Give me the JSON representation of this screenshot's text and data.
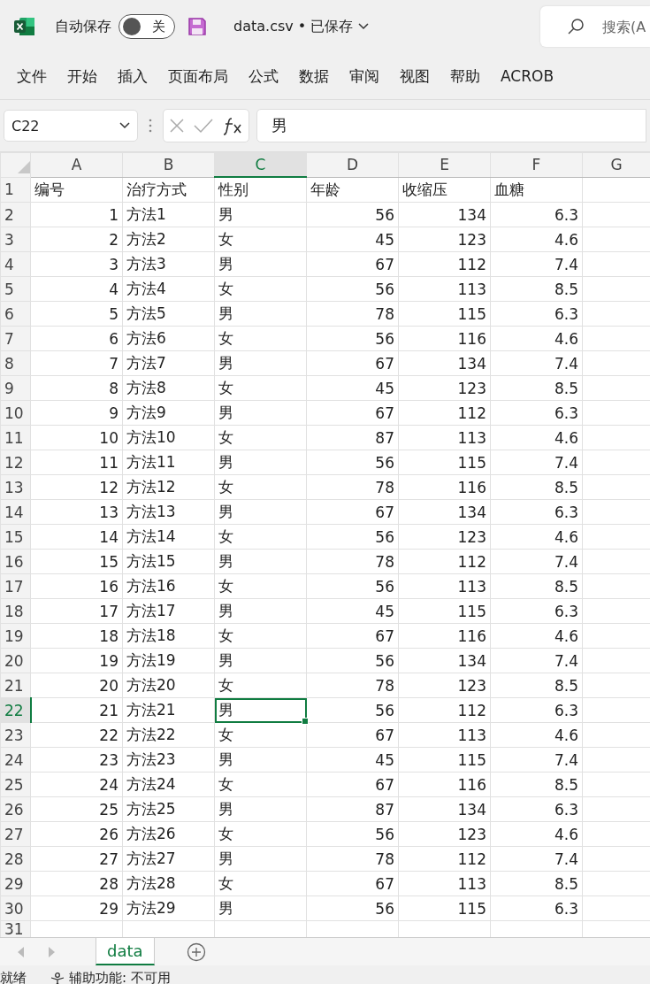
{
  "title_bar": {
    "autosave_label": "自动保存",
    "autosave_on": false,
    "autosave_state": "关",
    "file_title": "data.csv • 已保存",
    "search": {
      "placeholder": "搜索(A"
    }
  },
  "ribbon_tabs": [
    {
      "label": "文件",
      "selected": false
    },
    {
      "label": "开始",
      "selected": false
    },
    {
      "label": "插入",
      "selected": false
    },
    {
      "label": "页面布局",
      "selected": false
    },
    {
      "label": "公式",
      "selected": false
    },
    {
      "label": "数据",
      "selected": false
    },
    {
      "label": "审阅",
      "selected": false
    },
    {
      "label": "视图",
      "selected": false
    },
    {
      "label": "帮助",
      "selected": false
    },
    {
      "label": "ACROB",
      "selected": false
    }
  ],
  "formula_bar": {
    "name_box": "C22",
    "value": "男"
  },
  "grid": {
    "columns": [
      {
        "label": "A",
        "kind": "number",
        "selected": false
      },
      {
        "label": "B",
        "kind": "text",
        "selected": false
      },
      {
        "label": "C",
        "kind": "text",
        "selected": true
      },
      {
        "label": "D",
        "kind": "number",
        "selected": false
      },
      {
        "label": "E",
        "kind": "number",
        "selected": false
      },
      {
        "label": "F",
        "kind": "number",
        "selected": false
      },
      {
        "label": "G",
        "kind": "text",
        "selected": false
      }
    ],
    "rows": [
      {
        "number": "1",
        "selected": false,
        "cells": [
          "编号",
          "治疗方式",
          "性别",
          "年龄",
          "收缩压",
          "血糖"
        ],
        "header": true
      },
      {
        "number": "2",
        "selected": false,
        "cells": [
          "1",
          "方法1",
          "男",
          "56",
          "134",
          "6.3"
        ]
      },
      {
        "number": "3",
        "selected": false,
        "cells": [
          "2",
          "方法2",
          "女",
          "45",
          "123",
          "4.6"
        ]
      },
      {
        "number": "4",
        "selected": false,
        "cells": [
          "3",
          "方法3",
          "男",
          "67",
          "112",
          "7.4"
        ]
      },
      {
        "number": "5",
        "selected": false,
        "cells": [
          "4",
          "方法4",
          "女",
          "56",
          "113",
          "8.5"
        ]
      },
      {
        "number": "6",
        "selected": false,
        "cells": [
          "5",
          "方法5",
          "男",
          "78",
          "115",
          "6.3"
        ]
      },
      {
        "number": "7",
        "selected": false,
        "cells": [
          "6",
          "方法6",
          "女",
          "56",
          "116",
          "4.6"
        ]
      },
      {
        "number": "8",
        "selected": false,
        "cells": [
          "7",
          "方法7",
          "男",
          "67",
          "134",
          "7.4"
        ]
      },
      {
        "number": "9",
        "selected": false,
        "cells": [
          "8",
          "方法8",
          "女",
          "45",
          "123",
          "8.5"
        ]
      },
      {
        "number": "10",
        "selected": false,
        "cells": [
          "9",
          "方法9",
          "男",
          "67",
          "112",
          "6.3"
        ]
      },
      {
        "number": "11",
        "selected": false,
        "cells": [
          "10",
          "方法10",
          "女",
          "87",
          "113",
          "4.6"
        ]
      },
      {
        "number": "12",
        "selected": false,
        "cells": [
          "11",
          "方法11",
          "男",
          "56",
          "115",
          "7.4"
        ]
      },
      {
        "number": "13",
        "selected": false,
        "cells": [
          "12",
          "方法12",
          "女",
          "78",
          "116",
          "8.5"
        ]
      },
      {
        "number": "14",
        "selected": false,
        "cells": [
          "13",
          "方法13",
          "男",
          "67",
          "134",
          "6.3"
        ]
      },
      {
        "number": "15",
        "selected": false,
        "cells": [
          "14",
          "方法14",
          "女",
          "56",
          "123",
          "4.6"
        ]
      },
      {
        "number": "16",
        "selected": false,
        "cells": [
          "15",
          "方法15",
          "男",
          "78",
          "112",
          "7.4"
        ]
      },
      {
        "number": "17",
        "selected": false,
        "cells": [
          "16",
          "方法16",
          "女",
          "56",
          "113",
          "8.5"
        ]
      },
      {
        "number": "18",
        "selected": false,
        "cells": [
          "17",
          "方法17",
          "男",
          "45",
          "115",
          "6.3"
        ]
      },
      {
        "number": "19",
        "selected": false,
        "cells": [
          "18",
          "方法18",
          "女",
          "67",
          "116",
          "4.6"
        ]
      },
      {
        "number": "20",
        "selected": false,
        "cells": [
          "19",
          "方法19",
          "男",
          "56",
          "134",
          "7.4"
        ]
      },
      {
        "number": "21",
        "selected": false,
        "cells": [
          "20",
          "方法20",
          "女",
          "78",
          "123",
          "8.5"
        ]
      },
      {
        "number": "22",
        "selected": true,
        "cells": [
          "21",
          "方法21",
          "男",
          "56",
          "112",
          "6.3"
        ]
      },
      {
        "number": "23",
        "selected": false,
        "cells": [
          "22",
          "方法22",
          "女",
          "67",
          "113",
          "4.6"
        ]
      },
      {
        "number": "24",
        "selected": false,
        "cells": [
          "23",
          "方法23",
          "男",
          "45",
          "115",
          "7.4"
        ]
      },
      {
        "number": "25",
        "selected": false,
        "cells": [
          "24",
          "方法24",
          "女",
          "67",
          "116",
          "8.5"
        ]
      },
      {
        "number": "26",
        "selected": false,
        "cells": [
          "25",
          "方法25",
          "男",
          "87",
          "134",
          "6.3"
        ]
      },
      {
        "number": "27",
        "selected": false,
        "cells": [
          "26",
          "方法26",
          "女",
          "56",
          "123",
          "4.6"
        ]
      },
      {
        "number": "28",
        "selected": false,
        "cells": [
          "27",
          "方法27",
          "男",
          "78",
          "112",
          "7.4"
        ]
      },
      {
        "number": "29",
        "selected": false,
        "cells": [
          "28",
          "方法28",
          "女",
          "67",
          "113",
          "8.5"
        ]
      },
      {
        "number": "30",
        "selected": false,
        "cells": [
          "29",
          "方法29",
          "男",
          "56",
          "115",
          "6.3"
        ]
      },
      {
        "number": "31",
        "selected": false,
        "cells": []
      }
    ]
  },
  "sheet_tabs": [
    {
      "label": "data",
      "selected": true
    }
  ],
  "status_bar": {
    "ready": "就绪",
    "accessibility": "辅助功能: 不可用"
  }
}
